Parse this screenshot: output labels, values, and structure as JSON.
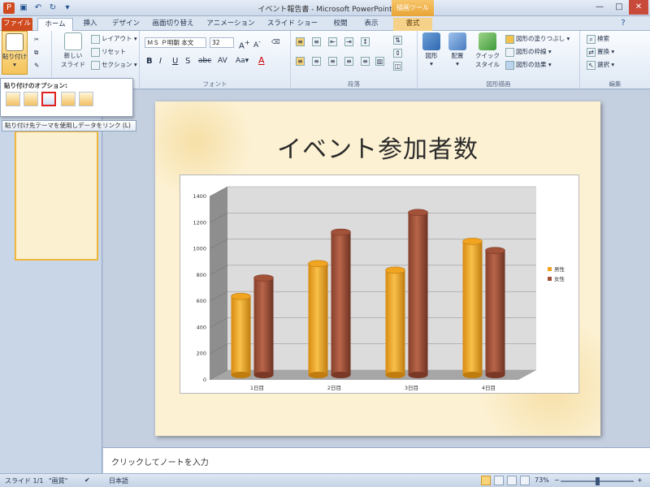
{
  "window": {
    "title": "イベント報告書 - Microsoft PowerPoint",
    "context_tab_group": "描画ツール"
  },
  "quick_access": [
    "save-icon",
    "undo-icon",
    "redo-icon",
    "customize-icon"
  ],
  "tabs": [
    {
      "label": "ファイル",
      "id": "file"
    },
    {
      "label": "ホーム",
      "id": "home"
    },
    {
      "label": "挿入",
      "id": "insert"
    },
    {
      "label": "デザイン",
      "id": "design"
    },
    {
      "label": "画面切り替え",
      "id": "transitions"
    },
    {
      "label": "アニメーション",
      "id": "animations"
    },
    {
      "label": "スライド ショー",
      "id": "slideshow"
    },
    {
      "label": "校閲",
      "id": "review"
    },
    {
      "label": "表示",
      "id": "view"
    },
    {
      "label": "書式",
      "id": "format"
    }
  ],
  "ribbon": {
    "clipboard": {
      "paste": "貼り付け"
    },
    "slides": {
      "new_slide": "新しい\nスライド",
      "layout": "レイアウト",
      "reset": "リセット",
      "section": "セクション"
    },
    "font": {
      "name": "ＭＳ Ｐ明朝 本文",
      "size": "32",
      "label": "フォント"
    },
    "paragraph": {
      "label": "段落"
    },
    "drawing": {
      "shapes": "図形",
      "arrange": "配置",
      "quick_styles": "クイック\nスタイル",
      "fill": "図形の塗りつぶし",
      "outline": "図形の枠線",
      "effects": "図形の効果",
      "label": "図形描画"
    },
    "editing": {
      "find": "検索",
      "replace": "置換",
      "select": "選択",
      "label": "編集"
    }
  },
  "paste_menu": {
    "title": "貼り付けのオプション:",
    "tooltip": "貼り付け先テーマを使用しデータをリンク (L)"
  },
  "slide": {
    "title": "イベント参加者数"
  },
  "chart_data": {
    "type": "bar",
    "categories": [
      "1日目",
      "2日目",
      "3日目",
      "4日目"
    ],
    "series": [
      {
        "name": "男性",
        "values": [
          600,
          850,
          800,
          1020
        ],
        "color": "#f0a420"
      },
      {
        "name": "女性",
        "values": [
          740,
          1090,
          1240,
          950
        ],
        "color": "#a3523a"
      }
    ],
    "ylim": [
      0,
      1400
    ],
    "yticks": [
      "0",
      "200",
      "400",
      "600",
      "800",
      "1000",
      "1200",
      "1400"
    ],
    "legend": "right",
    "grid": true
  },
  "notes": {
    "placeholder": "クリックしてノートを入力"
  },
  "status": {
    "slide": "スライド 1/1",
    "theme": "\"画質\"",
    "language": "日本語",
    "zoom": "73%",
    "zoom_fraction": 0.5
  }
}
